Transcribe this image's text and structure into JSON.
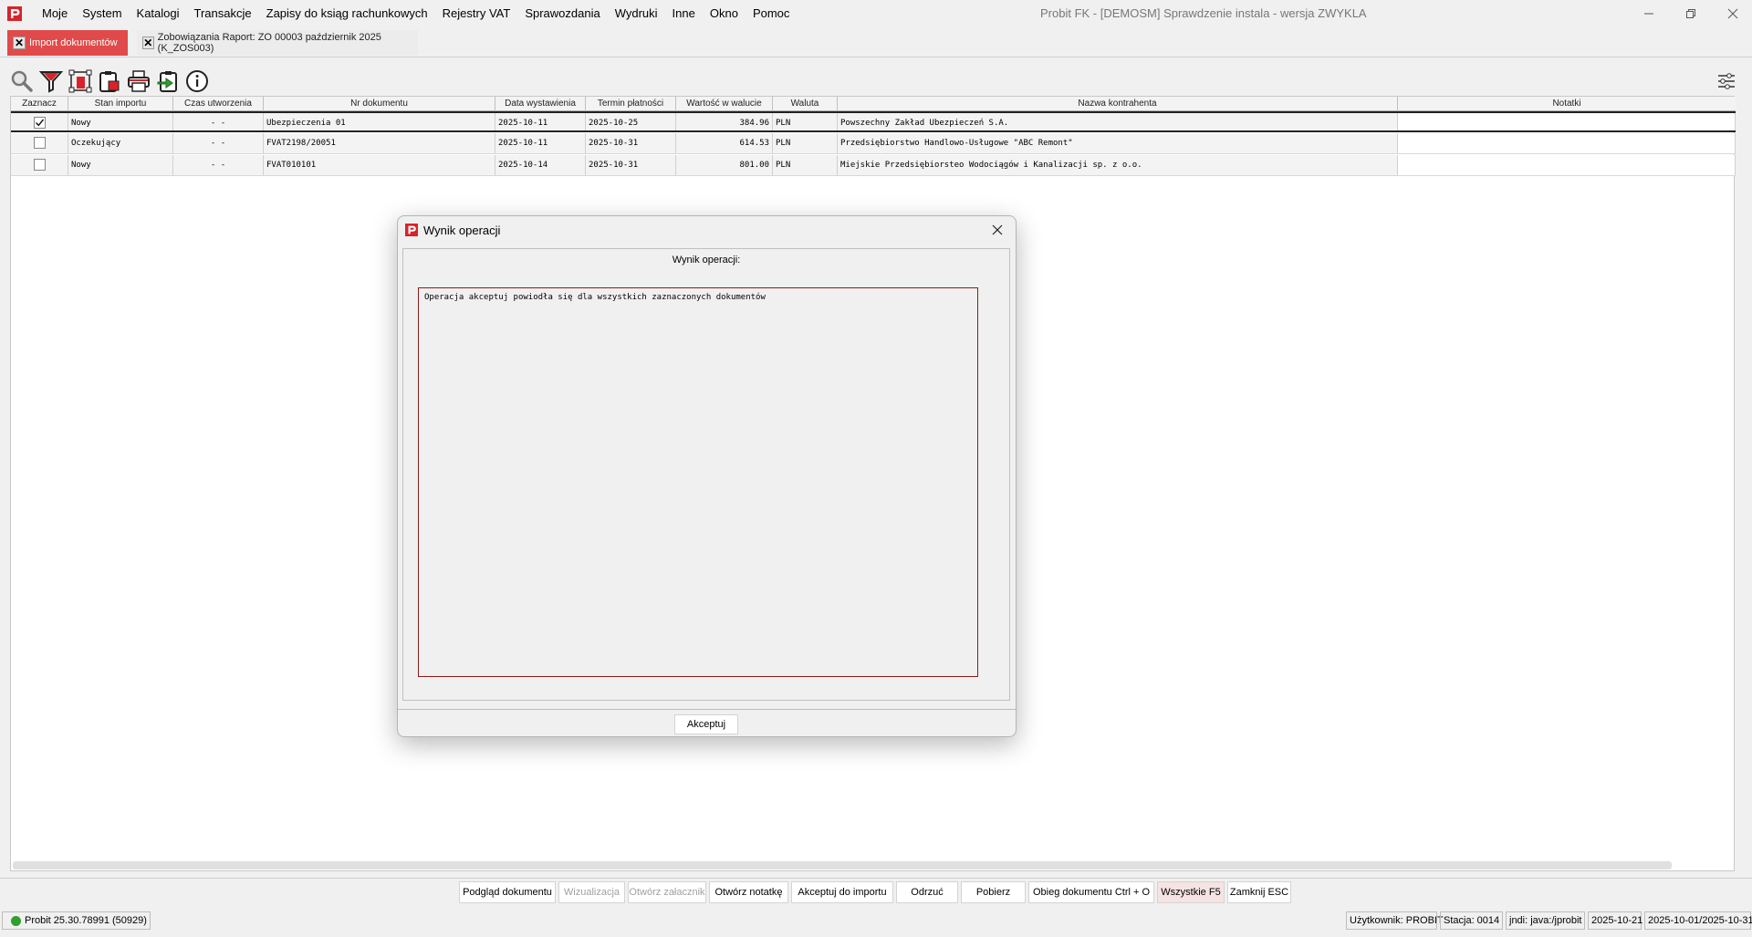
{
  "window": {
    "title": "Probit FK -  [DEMOSM] Sprawdzenie instala - wersja ZWYKLA"
  },
  "menu": [
    "Moje",
    "System",
    "Katalogi",
    "Transakcje",
    "Zapisy do ksiąg rachunkowych",
    "Rejestry VAT",
    "Sprawozdania",
    "Wydruki",
    "Inne",
    "Okno",
    "Pomoc"
  ],
  "tabs": [
    {
      "label": "Import dokumentów",
      "active": true
    },
    {
      "label": "Zobowiązania Raport: ZO 00003 październik 2025 (K_ZOS003)",
      "active": false
    }
  ],
  "toolbar_icons": [
    "search-icon",
    "filter-icon",
    "delete-icon",
    "clipboard-icon",
    "print-icon",
    "import-icon",
    "info-icon"
  ],
  "table": {
    "columns": [
      "Zaznacz",
      "Stan importu",
      "Czas utworzenia",
      "Nr dokumentu",
      "Data wystawienia",
      "Termin płatności",
      "Wartość w walucie",
      "Waluta",
      "Nazwa kontrahenta",
      "Notatki"
    ],
    "rows": [
      {
        "checked": true,
        "stan": "Nowy",
        "czas": "-  -",
        "nr": "Ubezpieczenia 01",
        "data": "2025-10-11",
        "termin": "2025-10-25",
        "wartosc": "384.96",
        "waluta": "PLN",
        "kontrahent": "Powszechny Zakład Ubezpieczeń S.A.",
        "notatki": ""
      },
      {
        "checked": false,
        "stan": "Oczekujący",
        "czas": "-  -",
        "nr": "FVAT2198/20051",
        "data": "2025-10-11",
        "termin": "2025-10-31",
        "wartosc": "614.53",
        "waluta": "PLN",
        "kontrahent": "Przedsiębiorstwo Handlowo-Usługowe \"ABC Remont\"",
        "notatki": ""
      },
      {
        "checked": false,
        "stan": "Nowy",
        "czas": "-  -",
        "nr": "FVAT010101",
        "data": "2025-10-14",
        "termin": "2025-10-31",
        "wartosc": "801.00",
        "waluta": "PLN",
        "kontrahent": "Miejskie Przedsiębiorsteo Wodociągów i Kanalizacji sp. z o.o.",
        "notatki": ""
      }
    ]
  },
  "dialog": {
    "title": "Wynik operacji",
    "label": "Wynik operacji:",
    "message": "Operacja akceptuj powiodła się dla wszystkich zaznaczonych dokumentów",
    "accept_button": "Akceptuj"
  },
  "bottom_buttons": [
    {
      "label": "Podgląd dokumentu",
      "state": "enabled"
    },
    {
      "label": "Wizualizacja",
      "state": "disabled"
    },
    {
      "label": "Otwórz załacznik",
      "state": "disabled"
    },
    {
      "label": "Otwórz notatkę",
      "state": "enabled"
    },
    {
      "label": "Akceptuj do importu",
      "state": "enabled"
    },
    {
      "label": "Odrzuć",
      "state": "enabled"
    },
    {
      "label": "Pobierz",
      "state": "enabled"
    },
    {
      "label": "Obieg dokumentu Ctrl + O",
      "state": "enabled"
    },
    {
      "label": "Wszystkie F5",
      "state": "highlighted"
    },
    {
      "label": "Zamknij ESC",
      "state": "enabled"
    }
  ],
  "status": {
    "version": "Probit 25.30.78991 (50929)",
    "user": "Użytkownik: PROBIT",
    "station": "Stacja: 0014",
    "jndi": "jndi: java:/jprobit",
    "date": "2025-10-21",
    "period": "2025-10-01/2025-10-31"
  },
  "colors": {
    "accent": "#e04a4a",
    "dialog_border": "#8b1a1a",
    "status_ok": "#2da02d"
  }
}
